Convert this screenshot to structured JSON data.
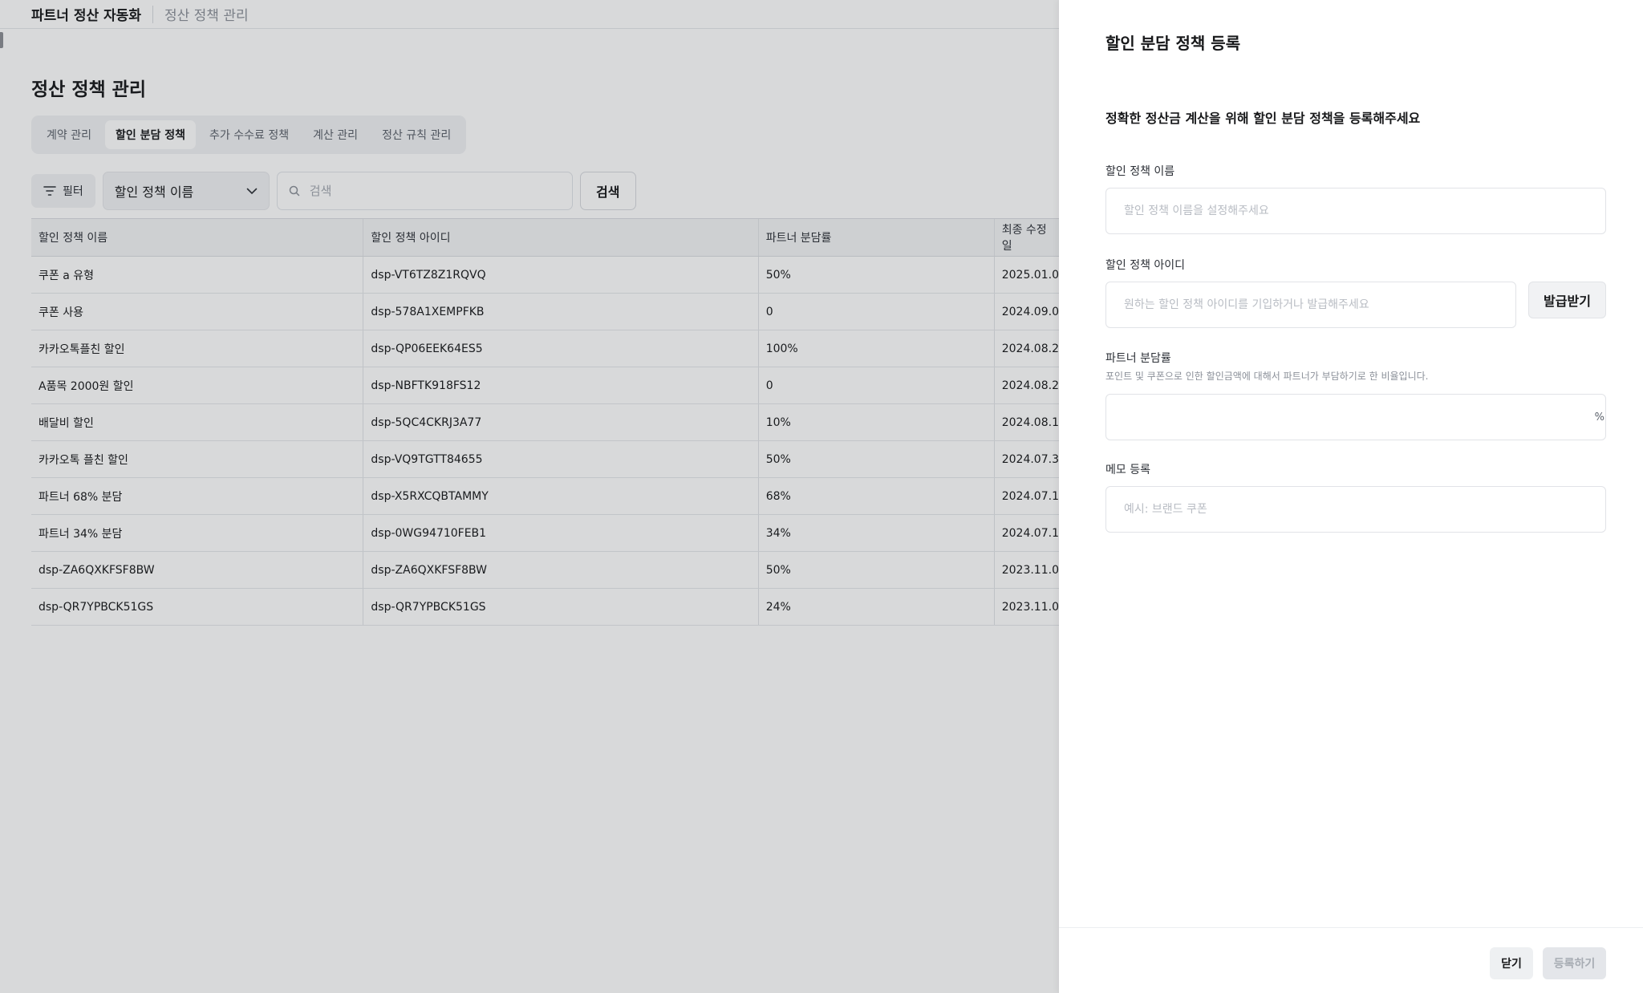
{
  "header": {
    "app_title": "파트너 정산 자동화",
    "breadcrumb": "정산 정책 관리"
  },
  "page": {
    "title": "정산 정책 관리"
  },
  "tabs": [
    {
      "label": "계약 관리",
      "active": false
    },
    {
      "label": "할인 분담 정책",
      "active": true
    },
    {
      "label": "추가 수수료 정책",
      "active": false
    },
    {
      "label": "계산 관리",
      "active": false
    },
    {
      "label": "정산 규칙 관리",
      "active": false
    }
  ],
  "toolbar": {
    "filter_label": "필터",
    "select_value": "할인 정책 이름",
    "search_placeholder": "검색",
    "search_button": "검색"
  },
  "table": {
    "columns": [
      "할인 정책 이름",
      "할인 정책 아이디",
      "파트너 분담률",
      "최종 수정 일"
    ],
    "rows": [
      [
        "쿠폰 a 유형",
        "dsp-VT6TZ8Z1RQVQ",
        "50%",
        "2025.01.0"
      ],
      [
        "쿠폰 사용",
        "dsp-578A1XEMPFKB",
        "0",
        "2024.09.0"
      ],
      [
        "카카오톡플친 할인",
        "dsp-QP06EEK64ES5",
        "100%",
        "2024.08.2"
      ],
      [
        "A품목 2000원 할인",
        "dsp-NBFTK918FS12",
        "0",
        "2024.08.2"
      ],
      [
        "배달비 할인",
        "dsp-5QC4CKRJ3A77",
        "10%",
        "2024.08.1"
      ],
      [
        "카카오톡 플친 할인",
        "dsp-VQ9TGTT84655",
        "50%",
        "2024.07.3"
      ],
      [
        "파트너 68% 분담",
        "dsp-X5RXCQBTAMMY",
        "68%",
        "2024.07.1"
      ],
      [
        "파트너 34% 분담",
        "dsp-0WG94710FEB1",
        "34%",
        "2024.07.1"
      ],
      [
        "dsp-ZA6QXKFSF8BW",
        "dsp-ZA6QXKFSF8BW",
        "50%",
        "2023.11.0"
      ],
      [
        "dsp-QR7YPBCK51GS",
        "dsp-QR7YPBCK51GS",
        "24%",
        "2023.11.0"
      ]
    ]
  },
  "drawer": {
    "title": "할인 분담 정책 등록",
    "subtitle": "정확한 정산금 계산을 위해 할인 분담 정책을 등록해주세요",
    "name_label": "할인 정책 이름",
    "name_placeholder": "할인 정책 이름을 설정해주세요",
    "id_label": "할인 정책 아이디",
    "id_placeholder": "원하는 할인 정책 아이디를 기입하거나 발급해주세요",
    "issue_button": "발급받기",
    "rate_label": "파트너 분담률",
    "rate_help": "포인트 및 쿠폰으로 인한 할인금액에 대해서 파트너가 부담하기로 한 비율입니다.",
    "rate_unit": "%",
    "memo_label": "메모 등록",
    "memo_placeholder": "예시: 브랜드 쿠폰",
    "close_button": "닫기",
    "submit_button": "등록하기"
  }
}
